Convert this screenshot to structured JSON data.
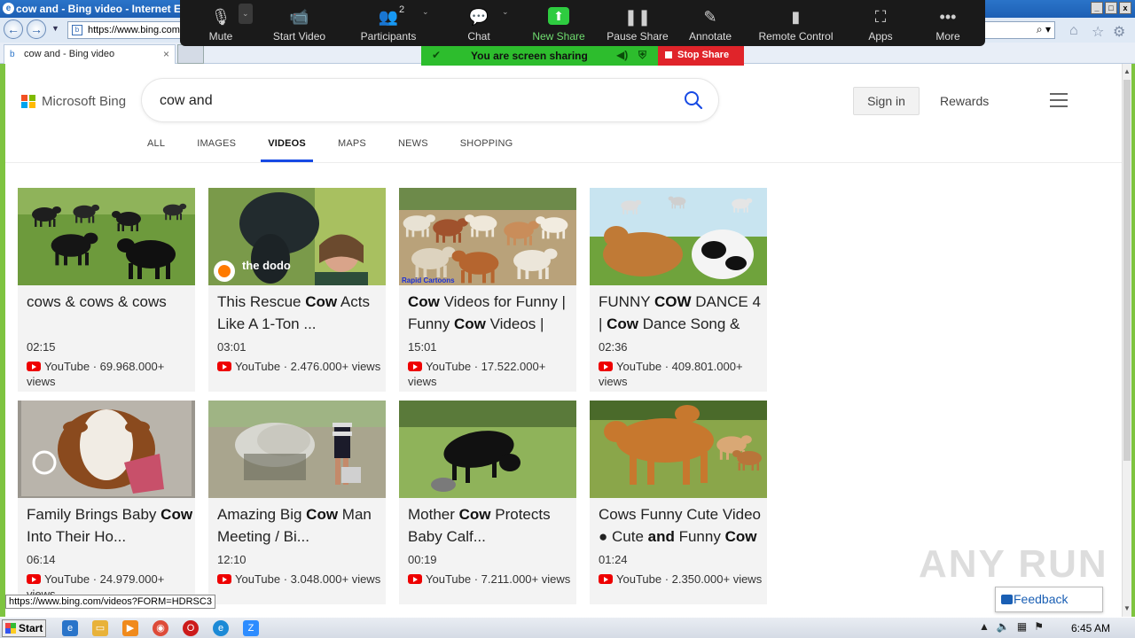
{
  "ie": {
    "window_title": "cow and - Bing video - Internet E",
    "address": "https://www.bing.com",
    "tab_label": "cow and - Bing video",
    "status_url": "https://www.bing.com/videos?FORM=HDRSC3"
  },
  "zoom": {
    "buttons": [
      {
        "label": "Mute",
        "icon": "microphone-icon"
      },
      {
        "label": "Start Video",
        "icon": "video-off-icon"
      },
      {
        "label": "Participants",
        "icon": "participants-icon",
        "count": "2"
      },
      {
        "label": "Chat",
        "icon": "chat-icon"
      },
      {
        "label": "New Share",
        "icon": "share-icon"
      },
      {
        "label": "Pause Share",
        "icon": "pause-icon"
      },
      {
        "label": "Annotate",
        "icon": "pencil-icon"
      },
      {
        "label": "Remote Control",
        "icon": "mouse-icon"
      },
      {
        "label": "Apps",
        "icon": "apps-icon"
      },
      {
        "label": "More",
        "icon": "more-icon"
      }
    ],
    "sharing_text": "You are screen sharing",
    "stop_share": "Stop Share",
    "colors": {
      "bar": "#1a1a1a",
      "green": "#2dbd2d",
      "red": "#e0242a"
    }
  },
  "bing": {
    "brand": "Microsoft Bing",
    "query": "cow and",
    "sign_in": "Sign in",
    "rewards": "Rewards",
    "tabs": [
      "ALL",
      "IMAGES",
      "VIDEOS",
      "MAPS",
      "NEWS",
      "SHOPPING"
    ],
    "active_tab": "VIDEOS",
    "accent": "#174ae4"
  },
  "videos": [
    {
      "title": [
        {
          "t": "cows & cows & cows",
          "b": false
        }
      ],
      "duration": "02:15",
      "source": "YouTube",
      "views": "69.968.000+ views"
    },
    {
      "title": [
        {
          "t": "This Rescue ",
          "b": false
        },
        {
          "t": "Cow",
          "b": true
        },
        {
          "t": " Acts Like A 1-Ton ...",
          "b": false
        }
      ],
      "duration": "03:01",
      "source": "YouTube",
      "views": "2.476.000+ views"
    },
    {
      "title": [
        {
          "t": "Cow",
          "b": true
        },
        {
          "t": " Videos for Funny | Funny ",
          "b": false
        },
        {
          "t": "Cow",
          "b": true
        },
        {
          "t": " Videos |",
          "b": false
        }
      ],
      "duration": "15:01",
      "source": "YouTube",
      "views": "17.522.000+ views"
    },
    {
      "title": [
        {
          "t": "FUNNY ",
          "b": false
        },
        {
          "t": "COW",
          "b": true
        },
        {
          "t": " DANCE 4 | ",
          "b": false
        },
        {
          "t": "Cow",
          "b": true
        },
        {
          "t": " Dance Song &",
          "b": false
        }
      ],
      "duration": "02:36",
      "source": "YouTube",
      "views": "409.801.000+ views"
    },
    {
      "title": [
        {
          "t": "Family Brings Baby ",
          "b": false
        },
        {
          "t": "Cow",
          "b": true
        },
        {
          "t": " Into Their Ho...",
          "b": false
        }
      ],
      "duration": "06:14",
      "source": "YouTube",
      "views": "24.979.000+ views"
    },
    {
      "title": [
        {
          "t": "Amazing Big ",
          "b": false
        },
        {
          "t": "Cow",
          "b": true
        },
        {
          "t": " Man Meeting / Bi...",
          "b": false
        }
      ],
      "duration": "12:10",
      "source": "YouTube",
      "views": "3.048.000+ views"
    },
    {
      "title": [
        {
          "t": "Mother ",
          "b": false
        },
        {
          "t": "Cow",
          "b": true
        },
        {
          "t": " Protects Baby Calf...",
          "b": false
        }
      ],
      "duration": "00:19",
      "source": "YouTube",
      "views": "7.211.000+ views"
    },
    {
      "title": [
        {
          "t": "Cows Funny Cute Video ● Cute ",
          "b": false
        },
        {
          "t": "and",
          "b": true
        },
        {
          "t": " Funny ",
          "b": false
        },
        {
          "t": "Cow",
          "b": true
        }
      ],
      "duration": "01:24",
      "source": "YouTube",
      "views": "2.350.000+ views"
    }
  ],
  "thumb_labels": {
    "dodo": "the dodo",
    "rapid": "Rapid Cartoons"
  },
  "feedback": "Feedback",
  "watermark": "ANY RUN",
  "taskbar": {
    "start": "Start",
    "clock": "6:45 AM"
  }
}
